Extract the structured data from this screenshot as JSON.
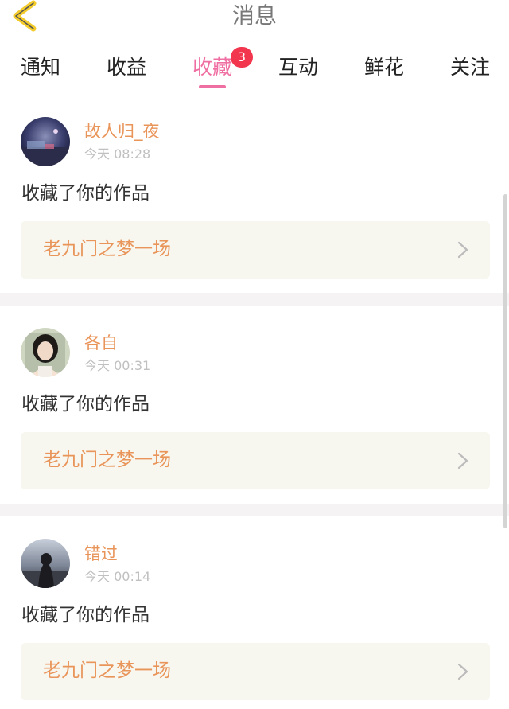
{
  "header": {
    "title": "消息"
  },
  "tabs": [
    {
      "label": "通知",
      "active": false
    },
    {
      "label": "收益",
      "active": false
    },
    {
      "label": "收藏",
      "active": true,
      "badge": "3"
    },
    {
      "label": "互动",
      "active": false
    },
    {
      "label": "鲜花",
      "active": false
    },
    {
      "label": "关注",
      "active": false
    }
  ],
  "feed": [
    {
      "username": "故人归_夜",
      "time": "今天 08:28",
      "action": "收藏了你的作品",
      "work_title": "老九门之梦一场",
      "avatar_icon": "night-scene-avatar"
    },
    {
      "username": "各自",
      "time": "今天 00:31",
      "action": "收藏了你的作品",
      "work_title": "老九门之梦一场",
      "avatar_icon": "girl-portrait-avatar"
    },
    {
      "username": "错过",
      "time": "今天 00:14",
      "action": "收藏了你的作品",
      "work_title": "老九门之梦一场",
      "avatar_icon": "silhouette-avatar"
    }
  ],
  "colors": {
    "accent": "#f06fa3",
    "badge": "#f1364e",
    "username": "#e9955a",
    "work_box_bg": "#f7f6ef",
    "back_arrow": "#f3cc2b"
  }
}
